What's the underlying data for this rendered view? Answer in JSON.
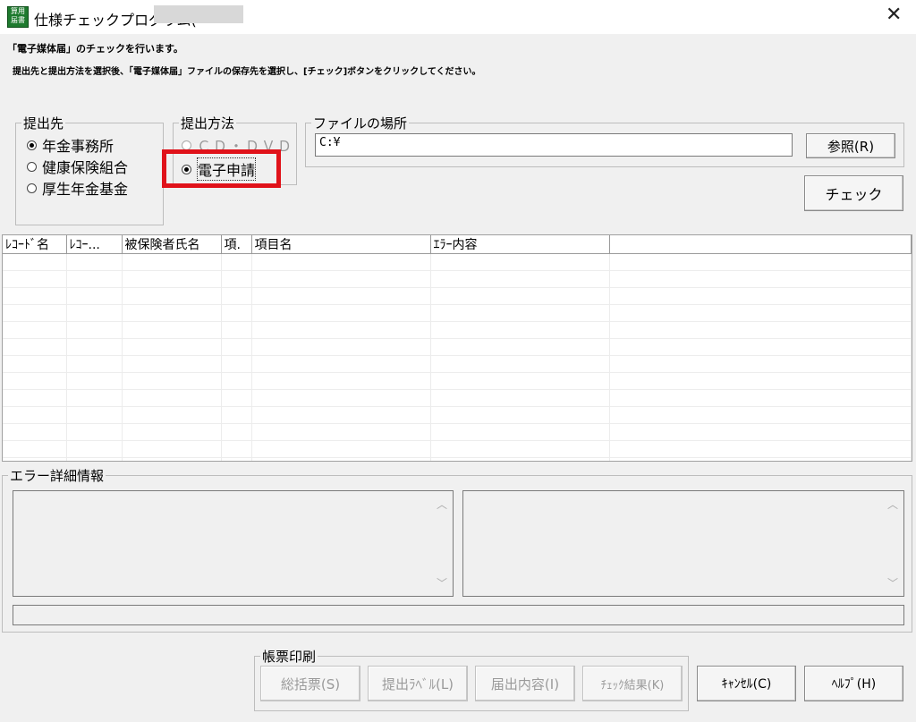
{
  "window": {
    "title": "仕様チェックプログラム(",
    "app_icon_text": "算用届書",
    "close_glyph": "✕"
  },
  "instructions": {
    "line1": "「電子媒体届」のチェックを行います。",
    "line2": "提出先と提出方法を選択後、「電子媒体届」ファイルの保存先を選択し、[チェック]ボタンをクリックしてください。"
  },
  "destination": {
    "legend": "提出先",
    "options": [
      {
        "label": "年金事務所",
        "selected": true
      },
      {
        "label": "健康保険組合",
        "selected": false
      },
      {
        "label": "厚生年金基金",
        "selected": false
      }
    ]
  },
  "method": {
    "legend": "提出方法",
    "options": [
      {
        "label": "ＣＤ・ＤＶＤ",
        "selected": false,
        "disabled": true
      },
      {
        "label": "電子申請",
        "selected": true,
        "disabled": false
      }
    ]
  },
  "file_location": {
    "legend": "ファイルの場所",
    "path": "C:¥",
    "browse_label": "参照(R)"
  },
  "check_button": "チェック",
  "grid": {
    "columns": [
      "ﾚｺｰﾄﾞ名",
      "ﾚｺｰ...",
      "被保険者氏名",
      "項.",
      "項目名",
      "ｴﾗｰ内容",
      ""
    ]
  },
  "error_detail": {
    "legend": "エラー詳細情報"
  },
  "print": {
    "legend": "帳票印刷",
    "buttons": [
      "総括票(S)",
      "提出ﾗﾍﾞﾙ(L)",
      "届出内容(I)",
      "ﾁｪｯｸ結果(K)"
    ]
  },
  "cancel_button": "ｷｬﾝｾﾙ(C)",
  "help_button": "ﾍﾙﾌﾟ(H)",
  "colors": {
    "highlight": "#e0121a",
    "window_bg": "#f0f0f0"
  }
}
